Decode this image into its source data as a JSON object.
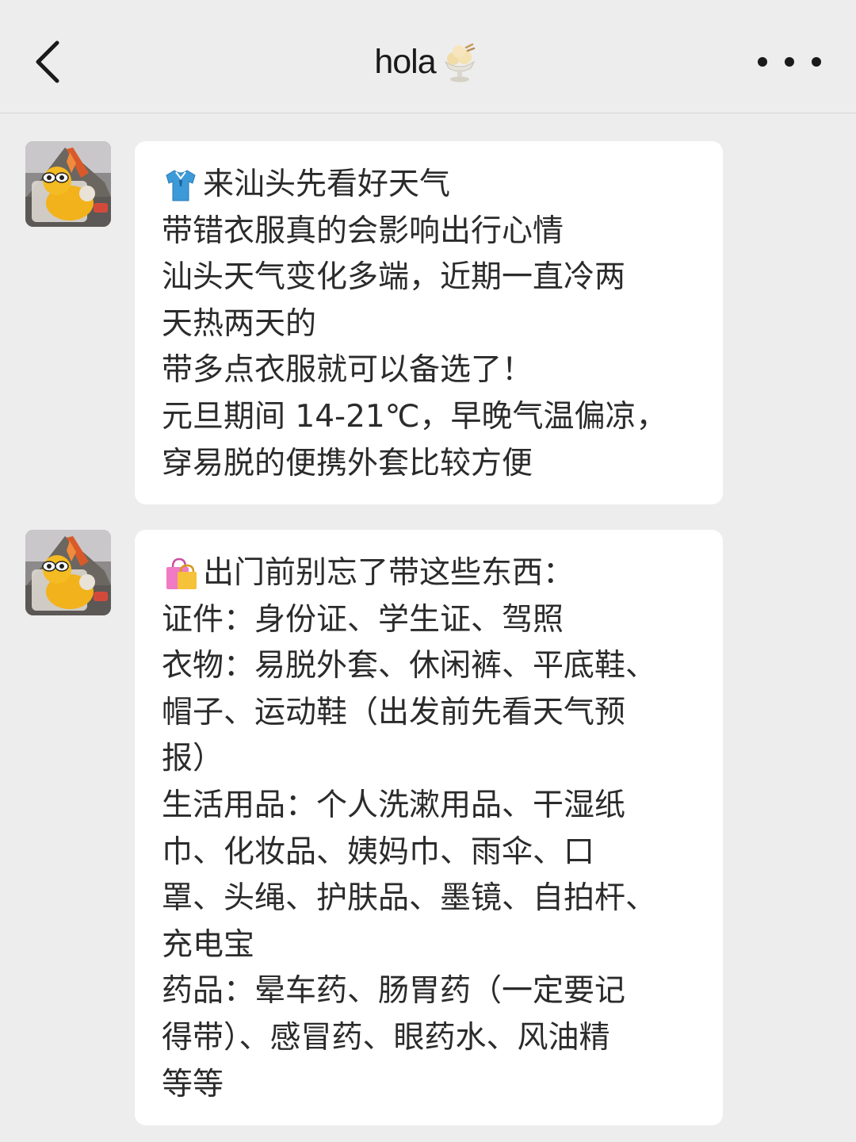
{
  "header": {
    "back_icon": "chevron-left-icon",
    "title": "hola",
    "title_emoji": "ice-cream-sundae-icon",
    "more_icon": "more-horizontal-icon"
  },
  "messages": [
    {
      "sender": "other",
      "avatar": "winnie-pooh-avatar",
      "leading_icon": "t-shirt-icon",
      "lines": [
        "来汕头先看好天气",
        "带错衣服真的会影响出行心情",
        "汕头天气变化多端，近期一直冷两",
        "天热两天的",
        "带多点衣服就可以备选了！",
        "元旦期间 14-21℃，早晚气温偏凉，",
        "穿易脱的便携外套比较方便"
      ]
    },
    {
      "sender": "other",
      "avatar": "winnie-pooh-avatar",
      "leading_icon": "shopping-bags-icon",
      "lines": [
        "出门前别忘了带这些东西：",
        "证件：身份证、学生证、驾照",
        "衣物：易脱外套、休闲裤、平底鞋、",
        "帽子、运动鞋（出发前先看天气预",
        "报）",
        "生活用品：个人洗漱用品、干湿纸",
        "巾、化妆品、姨妈巾、雨伞、口",
        "罩、头绳、护肤品、墨镜、自拍杆、",
        "充电宝",
        "药品：晕车药、肠胃药（一定要记",
        "得带）、感冒药、眼药水、风油精",
        "等等"
      ]
    }
  ]
}
